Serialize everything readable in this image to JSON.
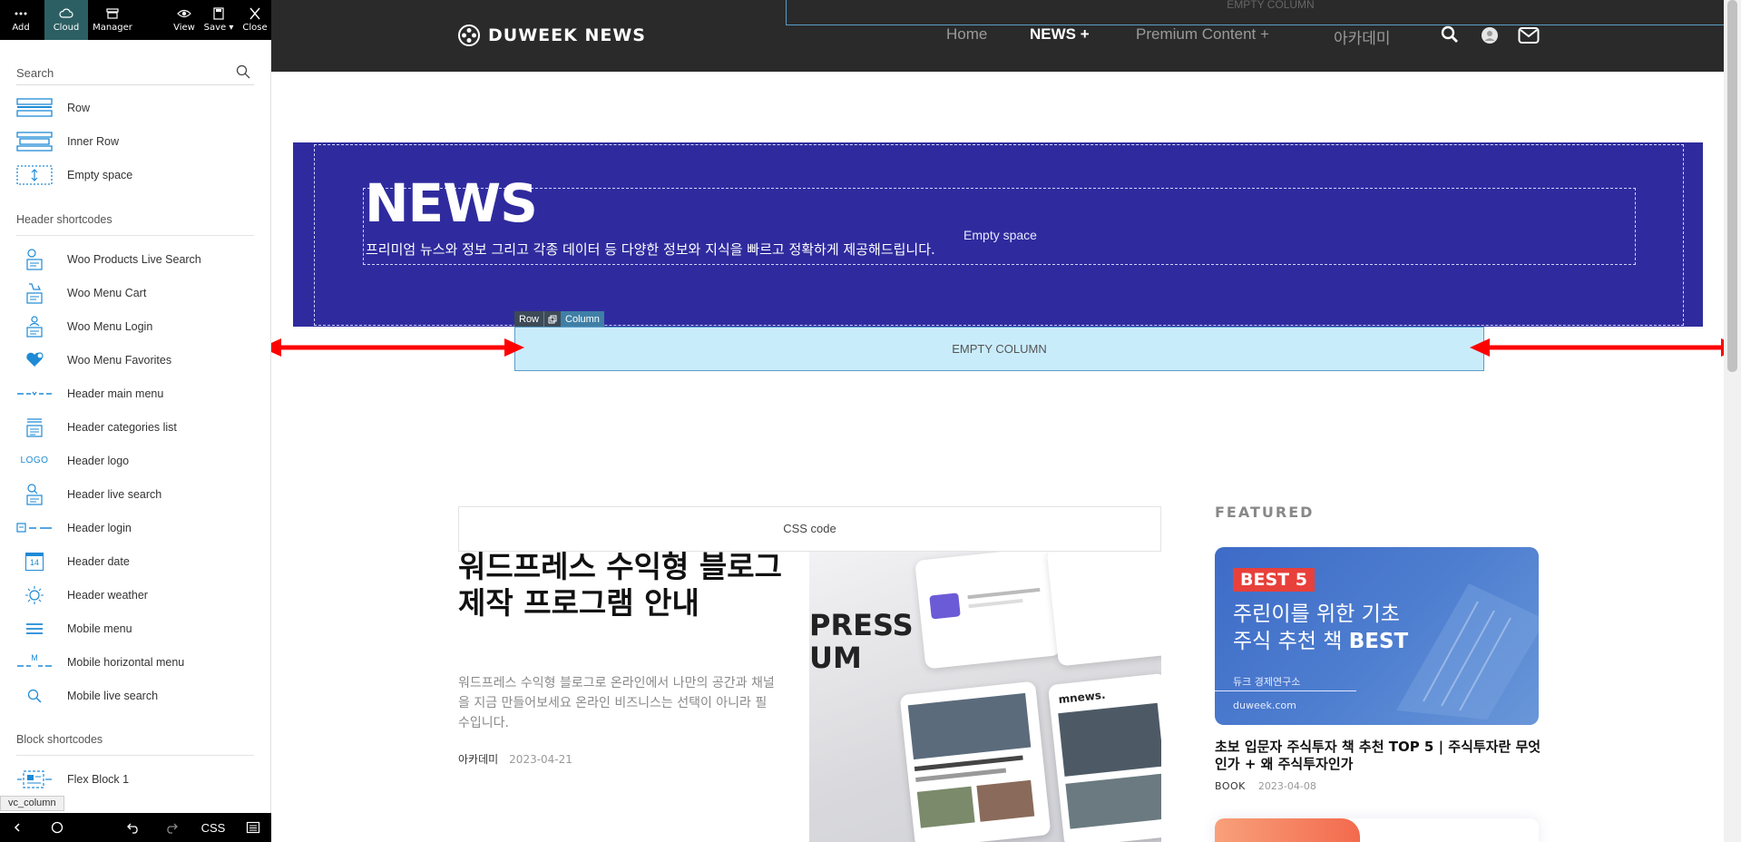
{
  "panel": {
    "toolbar": {
      "add": "Add",
      "cloud": "Cloud",
      "manager": "Manager",
      "view": "View",
      "save": "Save ▾",
      "close": "Close"
    },
    "search_placeholder": "Search",
    "items": [
      {
        "label": "Row",
        "icon": "row-icon"
      },
      {
        "label": "Inner Row",
        "icon": "inner-row-icon"
      },
      {
        "label": "Empty space",
        "icon": "empty-space-icon"
      }
    ],
    "header_section": "Header shortcodes",
    "header_items": [
      {
        "label": "Woo Products Live Search",
        "icon": "woo-search-icon"
      },
      {
        "label": "Woo Menu Cart",
        "icon": "cart-icon"
      },
      {
        "label": "Woo Menu Login",
        "icon": "login-icon"
      },
      {
        "label": "Woo Menu Favorites",
        "icon": "heart-icon"
      },
      {
        "label": "Header main menu",
        "icon": "main-menu-icon"
      },
      {
        "label": "Header categories list",
        "icon": "categories-icon"
      },
      {
        "label": "Header logo",
        "icon": "logo-icon",
        "icon_text": "LOGO"
      },
      {
        "label": "Header live search",
        "icon": "live-search-icon"
      },
      {
        "label": "Header login",
        "icon": "header-login-icon"
      },
      {
        "label": "Header date",
        "icon": "calendar-icon",
        "icon_text": "14"
      },
      {
        "label": "Header weather",
        "icon": "sun-icon"
      },
      {
        "label": "Mobile menu",
        "icon": "hamburger-icon"
      },
      {
        "label": "Mobile horizontal menu",
        "icon": "mobile-horizontal-menu-icon",
        "icon_text": "M"
      },
      {
        "label": "Mobile live search",
        "icon": "magnifier-icon"
      }
    ],
    "block_section": "Block shortcodes",
    "block_items": [
      {
        "label": "Flex Block 1",
        "icon": "flex-block-icon"
      }
    ],
    "element_tag": "vc_column",
    "bottom": {
      "css": "CSS"
    }
  },
  "site": {
    "logo_text": "DUWEEK NEWS",
    "nav": [
      {
        "label": "Home"
      },
      {
        "label": "NEWS  +",
        "active": true
      },
      {
        "label": "Premium Content  +"
      },
      {
        "label": "아카데미"
      }
    ],
    "top_column_label": "EMPTY COLUMN"
  },
  "hero": {
    "title": "NEWS",
    "subtitle": "프리미엄 뉴스와 정보 그리고 각종 데이터 등 다양한 정보와 지식을 빠르고 정확하게 제공해드립니다.",
    "empty_space_label": "Empty space",
    "bg_color": "#2f2b9e"
  },
  "builder": {
    "row_label": "Row",
    "column_label": "Column",
    "empty_column_label": "EMPTY COLUMN"
  },
  "article": {
    "css_box": "CSS code",
    "title": "워드프레스 수익형 블로그 제작 프로그램 안내",
    "excerpt": "워드프레스 수익형 블로그로 온라인에서 나만의 공간과 채널을 지금 만들어보세요 온라인 비즈니스는 선택이 아니라 필수입니다.",
    "category": "아카데미",
    "date": "2023-04-21",
    "image_text_1": "PRESS",
    "image_text_2": "UM",
    "image_text_3": "mnews."
  },
  "featured": {
    "heading": "FEATURED",
    "card": {
      "badge": "BEST 5",
      "line1": "주린이를 위한 기초",
      "line2_prefix": "주식 추천 책 ",
      "line2_bold": "BEST",
      "org": "듀크 경제연구소",
      "url": "duweek.com"
    },
    "title": "초보 입문자 주식투자 책 추천 TOP 5 | 주식투자란 무엇인가 + 왜 주식투자인가",
    "category": "BOOK",
    "date": "2023-04-08"
  },
  "colors": {
    "accent_teal": "#2c5f63",
    "header_dark": "#2a2a2a",
    "column_highlight": "#c9ecfb",
    "arrow_red": "#ff0000",
    "badge_red": "#e8403a"
  }
}
